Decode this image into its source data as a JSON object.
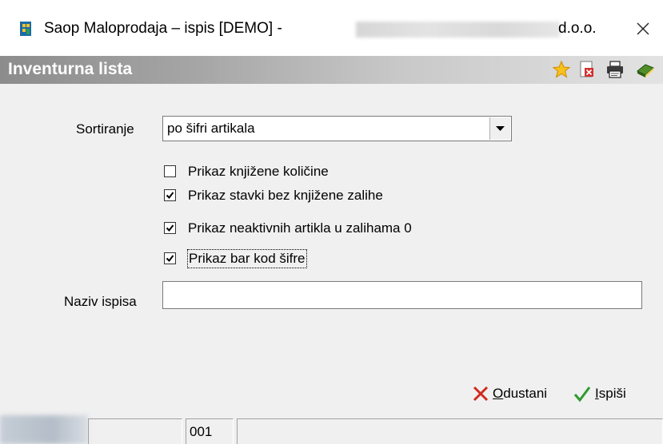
{
  "window": {
    "title": "Saop Maloprodaja – ispis [DEMO] -",
    "title_suffix": "d.o.o.",
    "close_glyph": "✕"
  },
  "panel": {
    "title": "Inventurna lista",
    "icons": [
      "star-icon",
      "pdf-export-icon",
      "printer-icon",
      "book-icon"
    ]
  },
  "form": {
    "sort_label": "Sortiranje",
    "sort_value": "po šifri artikala",
    "checkboxes": [
      {
        "label": "Prikaz knjižene količine",
        "checked": false
      },
      {
        "label": "Prikaz stavki bez knjižene zalihe",
        "checked": true
      },
      {
        "label": "Prikaz neaktivnih artikla u zalihama 0",
        "checked": true
      },
      {
        "label": "Prikaz bar kod šifre",
        "checked": true
      }
    ],
    "name_label": "Naziv ispisa",
    "name_value": ""
  },
  "buttons": {
    "cancel_mnemonic": "O",
    "cancel_rest": "dustani",
    "print_mnemonic": "I",
    "print_rest": "spiši"
  },
  "status": {
    "cell1": "001"
  },
  "colors": {
    "header_gradient_start": "#8c8c8c",
    "header_gradient_end": "#e3e3e3",
    "cancel_red": "#d12a1f",
    "ok_green": "#2e9a2e"
  }
}
